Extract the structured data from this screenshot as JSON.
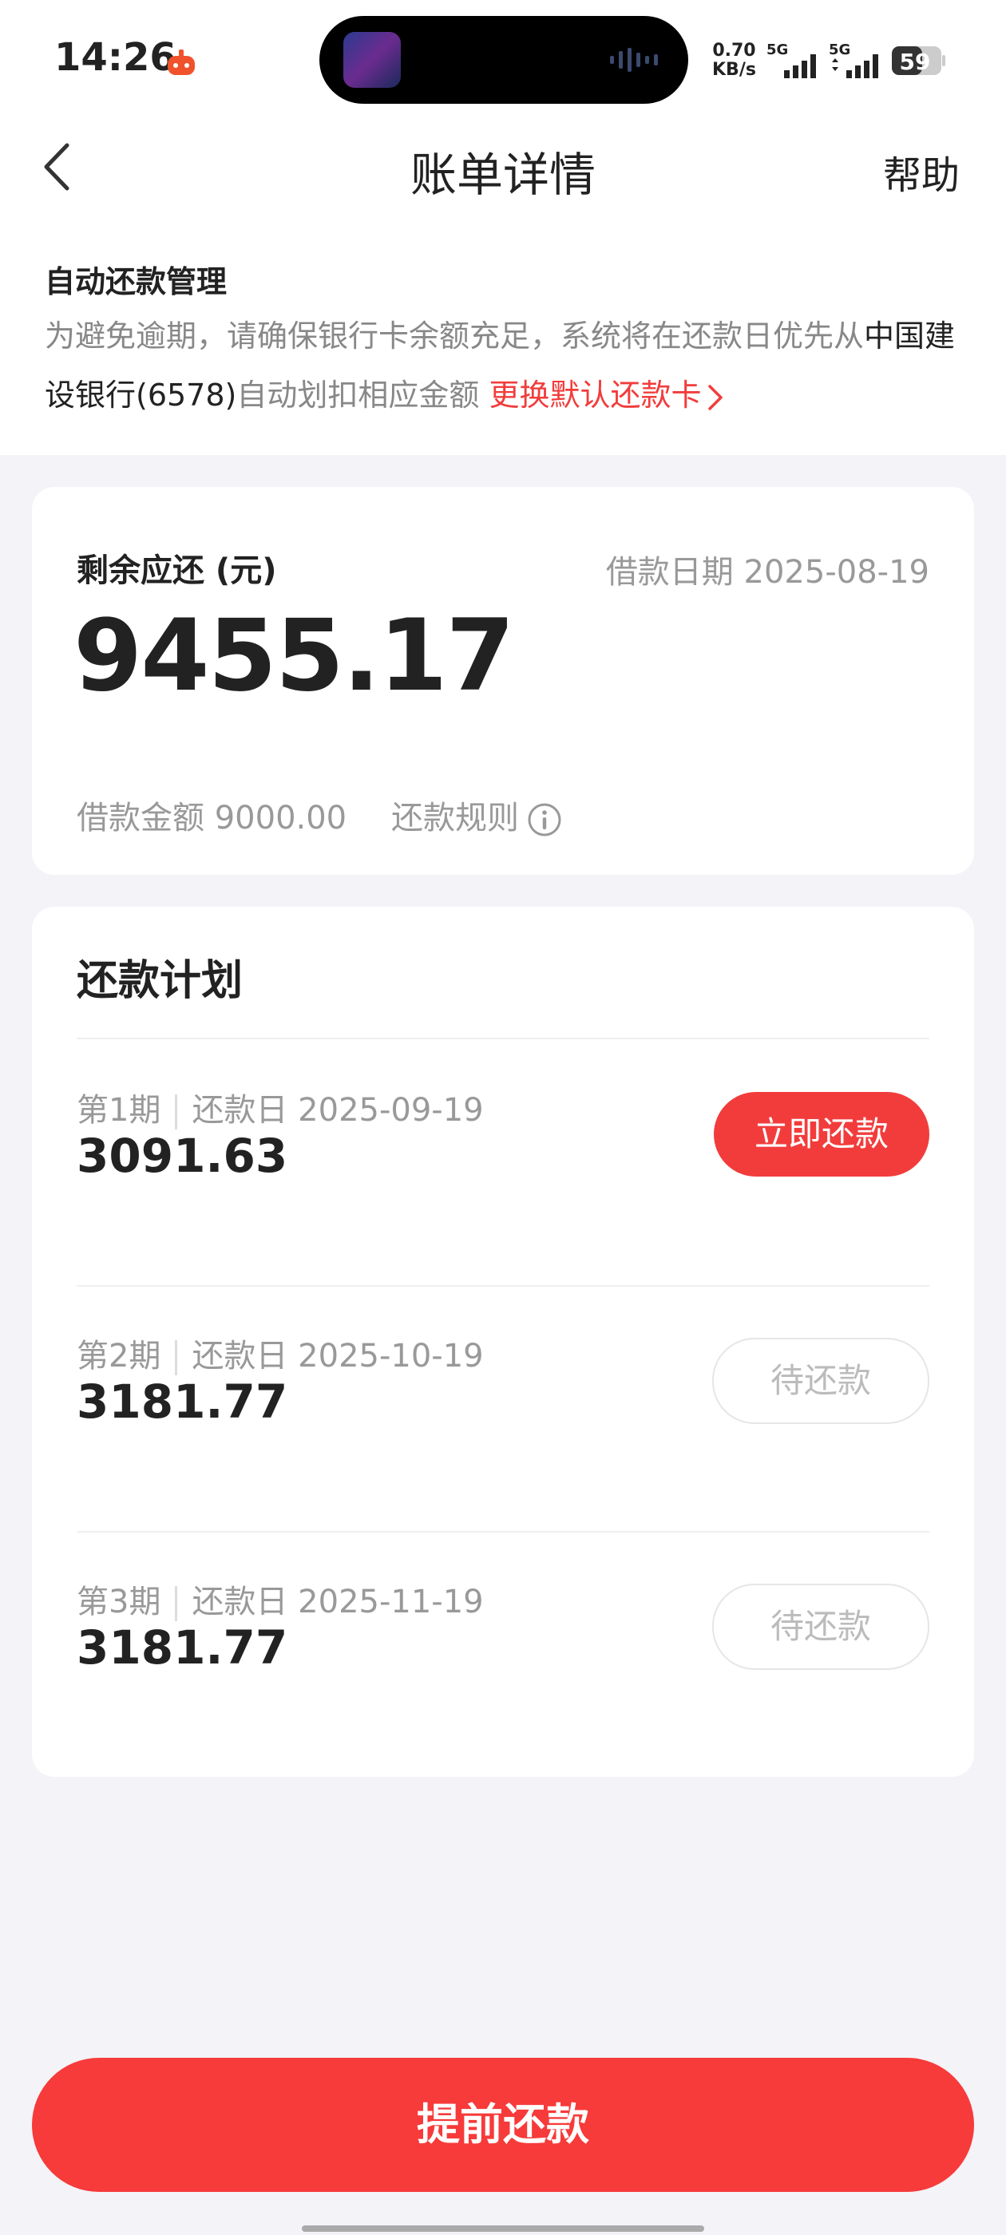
{
  "status_bar": {
    "time": "14:26",
    "net_speed_value": "0.70",
    "net_speed_unit": "KB/s",
    "sim1_label": "5G",
    "sim2_label": "5G",
    "battery": "59"
  },
  "header": {
    "title": "账单详情",
    "help": "帮助"
  },
  "auto_repay": {
    "title": "自动还款管理",
    "desc_prefix": "为避免逾期，请确保银行卡余额充足，系统将在还款日优先从",
    "bank": "中国建设银行(6578)",
    "desc_suffix": "自动划扣相应金额",
    "change_card": "更换默认还款卡"
  },
  "summary": {
    "remaining_label": "剩余应还 (元)",
    "loan_date_label": "借款日期",
    "loan_date": "2025-08-19",
    "remaining_amount": "9455.17",
    "loan_amount_label": "借款金额",
    "loan_amount": "9000.00",
    "rules_label": "还款规则"
  },
  "plan": {
    "title": "还款计划",
    "due_label": "还款日",
    "installments": [
      {
        "period": "第1期",
        "due_date": "2025-09-19",
        "amount": "3091.63",
        "action": "立即还款"
      },
      {
        "period": "第2期",
        "due_date": "2025-10-19",
        "amount": "3181.77",
        "action": "待还款"
      },
      {
        "period": "第3期",
        "due_date": "2025-11-19",
        "amount": "3181.77",
        "action": "待还款"
      }
    ]
  },
  "footer": {
    "prepay_button": "提前还款"
  },
  "colors": {
    "accent": "#f23c3c",
    "background": "#f3f3f8"
  }
}
